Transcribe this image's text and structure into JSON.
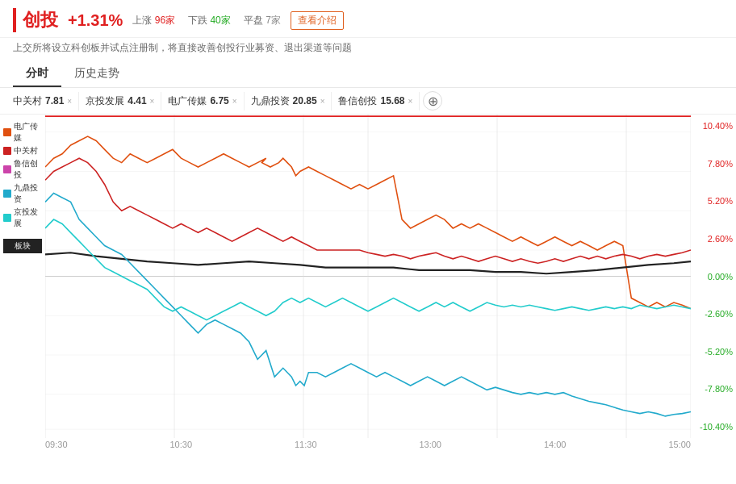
{
  "header": {
    "title": "创投",
    "change": "+1.31%",
    "up_label": "上涨",
    "up_count": "96家",
    "down_label": "下跌",
    "down_count": "40家",
    "flat_label": "平盘",
    "flat_count": "7家",
    "intro_btn": "查看介绍"
  },
  "subtitle": "上交所将设立科创板并试点注册制，将直接改善创投行业募资、退出渠道等问题",
  "tabs": [
    {
      "label": "分时",
      "active": true
    },
    {
      "label": "历史走势",
      "active": false
    }
  ],
  "stock_tabs": [
    {
      "name": "中关村",
      "price": "7.81"
    },
    {
      "name": "京投发展",
      "price": "4.41"
    },
    {
      "name": "电广传媒",
      "price": "6.75"
    },
    {
      "name": "九鼎投资",
      "price": "20.85"
    },
    {
      "name": "鲁信创投",
      "price": "15.68"
    }
  ],
  "legend": [
    {
      "label": "电广传媒",
      "color": "#e05010"
    },
    {
      "label": "中关村",
      "color": "#cc2222"
    },
    {
      "label": "鲁信创投",
      "color": "#cc44aa"
    },
    {
      "label": "九鼎投资",
      "color": "#22aacc"
    },
    {
      "label": "京投发展",
      "color": "#22cccc"
    },
    {
      "label": "板块",
      "color": "#222222",
      "is_block": true
    }
  ],
  "y_axis": [
    "10.40%",
    "7.80%",
    "5.20%",
    "2.60%",
    "0.00%",
    "-2.60%",
    "-5.20%",
    "-7.80%",
    "-10.40%"
  ],
  "x_axis": [
    "09:30",
    "10:30",
    "11:30",
    "13:00",
    "14:00",
    "15:00"
  ]
}
